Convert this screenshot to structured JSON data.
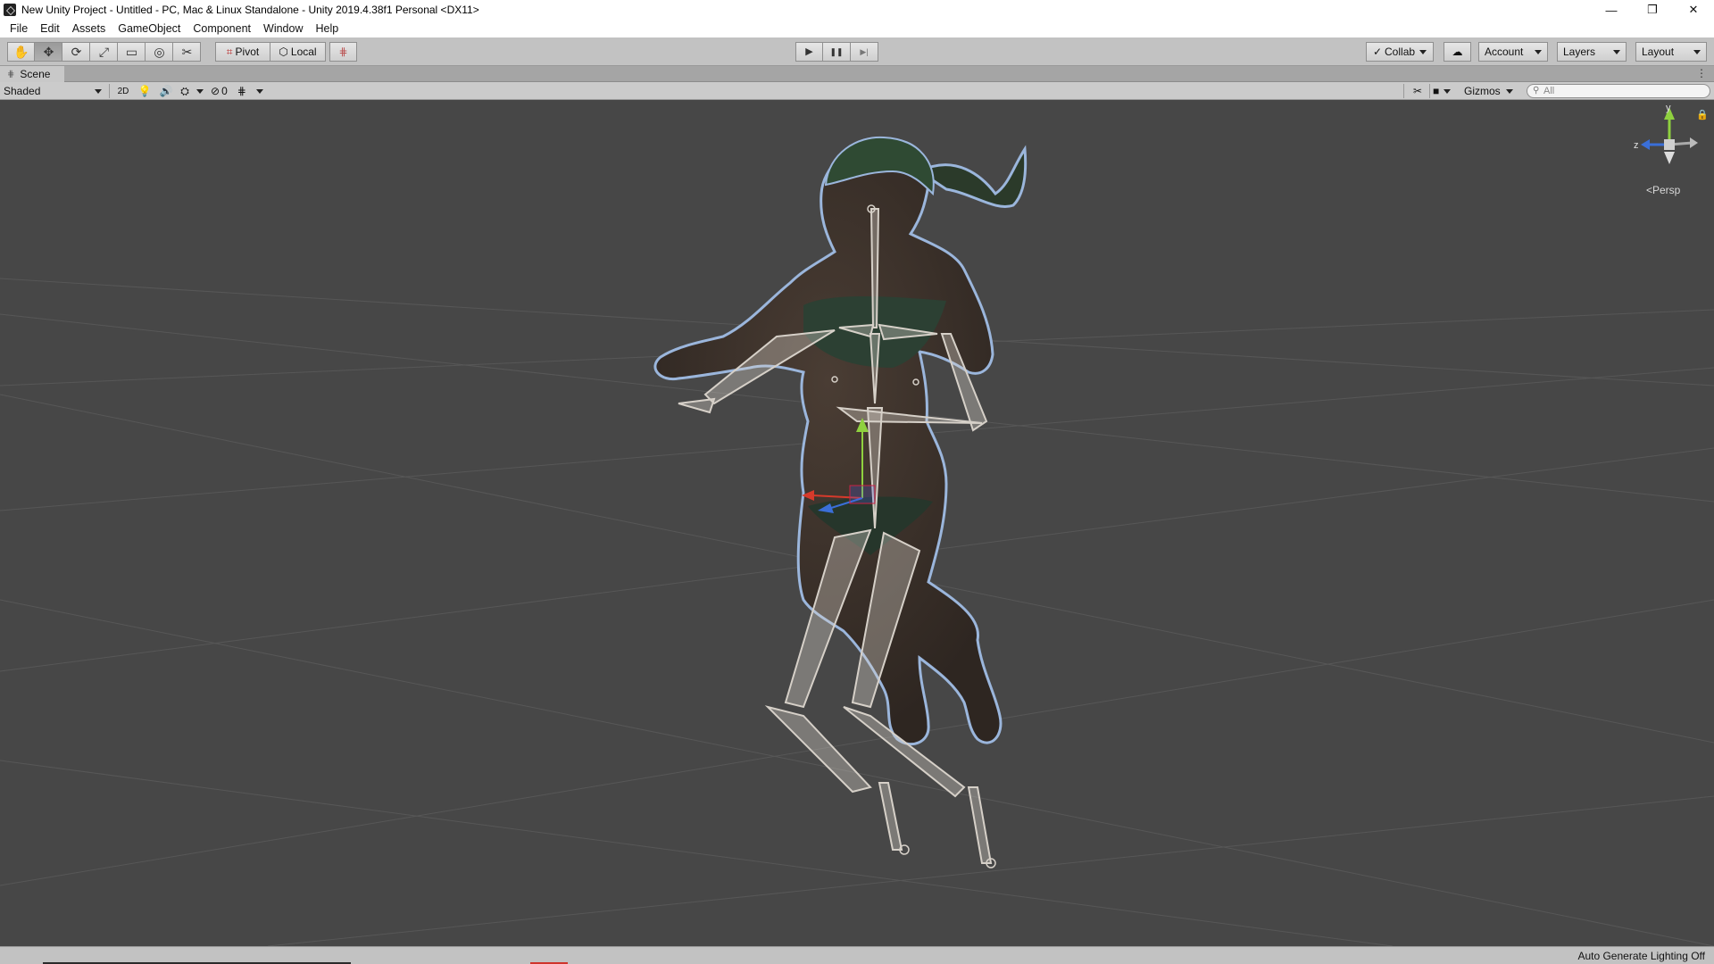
{
  "window": {
    "title": "New Unity Project - Untitled - PC, Mac & Linux Standalone - Unity 2019.4.38f1 Personal <DX11>",
    "minimize_glyph": "—",
    "maximize_glyph": "❐",
    "close_glyph": "✕"
  },
  "menu": [
    "File",
    "Edit",
    "Assets",
    "GameObject",
    "Component",
    "Window",
    "Help"
  ],
  "toolbar": {
    "tools": [
      {
        "name": "hand-tool",
        "glyph": "✋"
      },
      {
        "name": "move-tool",
        "glyph": "✥"
      },
      {
        "name": "rotate-tool",
        "glyph": "⟳"
      },
      {
        "name": "scale-tool",
        "glyph": "⤢"
      },
      {
        "name": "rect-tool",
        "glyph": "▭"
      },
      {
        "name": "transform-tool",
        "glyph": "◎"
      },
      {
        "name": "custom-tool",
        "glyph": "✂"
      }
    ],
    "pivot_label": "Pivot",
    "local_label": "Local",
    "play_glyph": "▶",
    "pause_glyph": "❚❚",
    "step_glyph": "▶|",
    "collab_label": "Collab",
    "account_label": "Account",
    "layers_label": "Layers",
    "layout_label": "Layout"
  },
  "scene": {
    "tab_label": "Scene",
    "draw_mode": "Shaded",
    "mode_2d": "2D",
    "hidden_count": "0",
    "gizmos_label": "Gizmos",
    "search_placeholder": "All",
    "persp_label": "<Persp",
    "axis_y": "y",
    "axis_z": "z"
  },
  "status": {
    "message": "Auto Generate Lighting Off"
  },
  "colors": {
    "viewport_bg": "#474747",
    "toolbar_bg": "#c2c2c2",
    "axis_x": "#d63a2b",
    "axis_y": "#8fd13f",
    "axis_z": "#3a6fd8",
    "selection_outline": "#9bb6dc"
  }
}
